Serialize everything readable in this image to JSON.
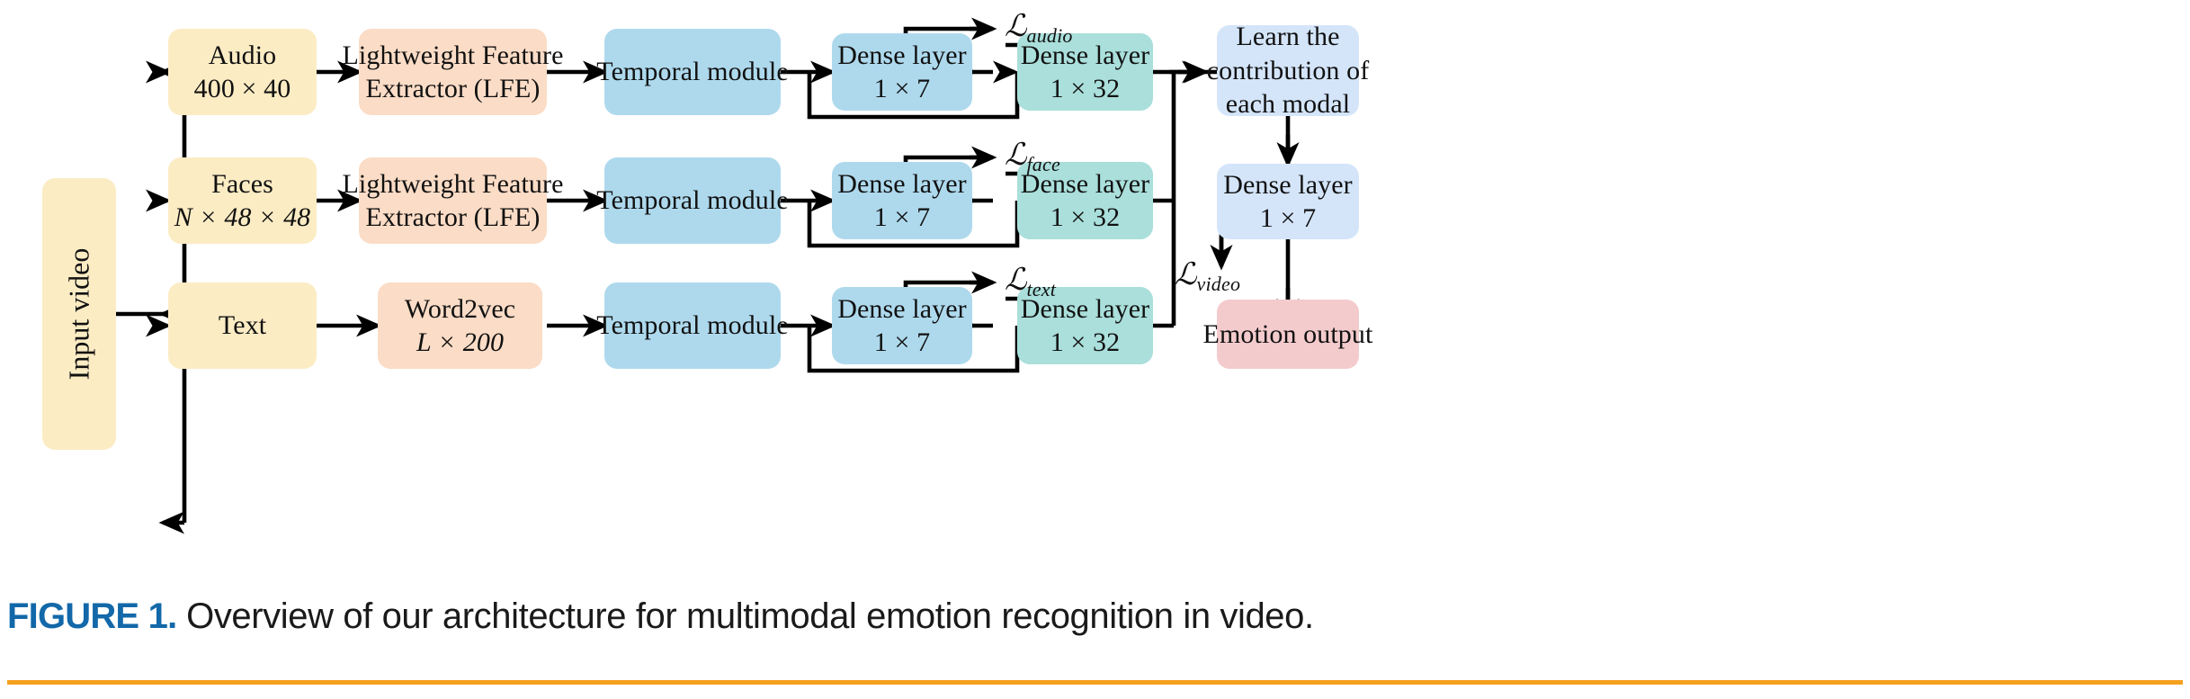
{
  "figure": {
    "caption_label": "FIGURE 1.",
    "caption_text": " Overview of our architecture for multimodal emotion recognition in video.",
    "accent_rule_color": "#f5a01e",
    "label_color": "#1268a8"
  },
  "diagram": {
    "title": "Overview of our architecture for multimodal emotion recognition in video",
    "input": {
      "label": "Input video",
      "color": "#fcecc4"
    },
    "modalities": [
      {
        "name": "audio",
        "source": {
          "line1": "Audio",
          "line2": "400 × 40",
          "color": "#fcecc4"
        },
        "extractor": {
          "line1": "Lightweight Feature",
          "line2": "Extractor (LFE)",
          "color": "#fbdcc6"
        },
        "temporal": {
          "line1": "Temporal module",
          "line2": "",
          "color": "#aed9ed"
        },
        "dense_a": {
          "line1": "Dense layer",
          "line2": "1 × 7",
          "color": "#aed9ed"
        },
        "dense_b": {
          "line1": "Dense layer",
          "line2": "1 × 32",
          "color": "#aadfdb"
        },
        "loss": {
          "symbol": "ℒ",
          "subscript": "audio"
        }
      },
      {
        "name": "face",
        "source": {
          "line1": "Faces",
          "line2": "N × 48 × 48",
          "color": "#fcecc4"
        },
        "extractor": {
          "line1": "Lightweight Feature",
          "line2": "Extractor (LFE)",
          "color": "#fbdcc6"
        },
        "temporal": {
          "line1": "Temporal module",
          "line2": "",
          "color": "#aed9ed"
        },
        "dense_a": {
          "line1": "Dense layer",
          "line2": "1 × 7",
          "color": "#aed9ed"
        },
        "dense_b": {
          "line1": "Dense layer",
          "line2": "1 × 32",
          "color": "#aadfdb"
        },
        "loss": {
          "symbol": "ℒ",
          "subscript": "face"
        }
      },
      {
        "name": "text",
        "source": {
          "line1": "Text",
          "line2": "",
          "color": "#fcecc4"
        },
        "extractor": {
          "line1": "Word2vec",
          "line2": "L × 200",
          "color": "#fbdcc6"
        },
        "temporal": {
          "line1": "Temporal module",
          "line2": "",
          "color": "#aed9ed"
        },
        "dense_a": {
          "line1": "Dense layer",
          "line2": "1 × 7",
          "color": "#aed9ed"
        },
        "dense_b": {
          "line1": "Dense layer",
          "line2": "1 × 32",
          "color": "#aadfdb"
        },
        "loss": {
          "symbol": "ℒ",
          "subscript": "text"
        }
      }
    ],
    "fusion": {
      "line1": "Learn the",
      "line2": "contribution of",
      "line3": "each modal",
      "color": "#d4e5fa"
    },
    "fusion_dense": {
      "line1": "Dense layer",
      "line2": "1 × 7",
      "color": "#d4e5fa"
    },
    "video_loss": {
      "symbol": "ℒ",
      "subscript": "video"
    },
    "output": {
      "label": "Emotion output",
      "color": "#f4cbcd"
    }
  }
}
